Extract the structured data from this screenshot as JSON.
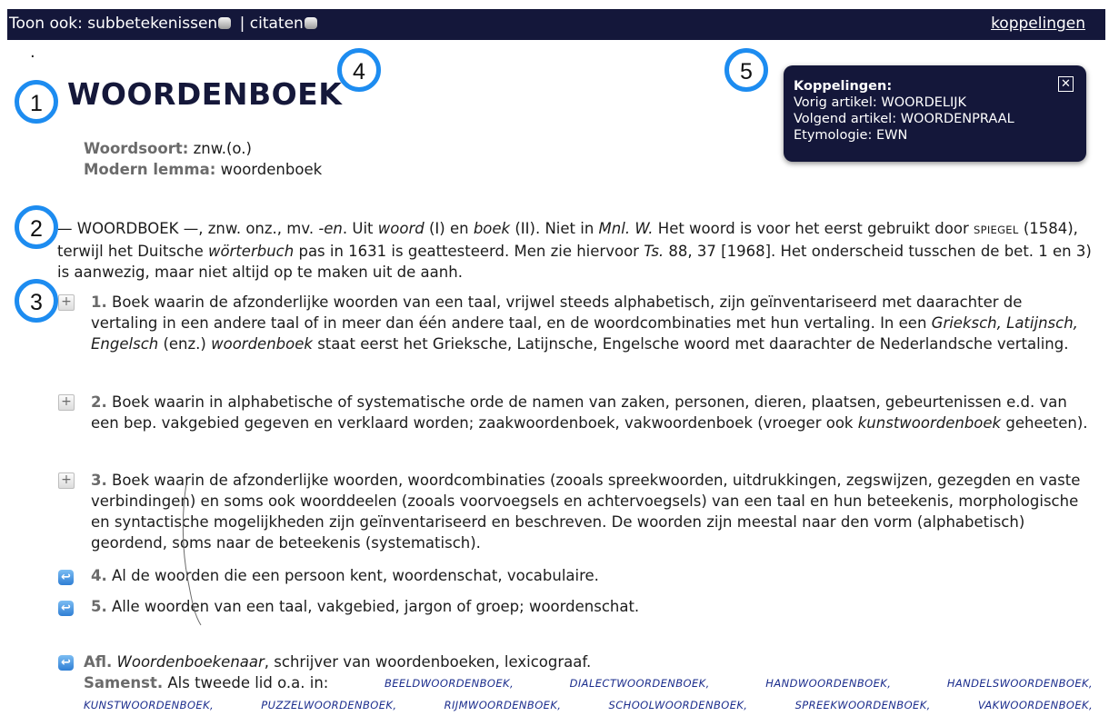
{
  "topbar": {
    "show_also": "Toon ook:",
    "subsenses": "subbetekenissen",
    "separator": "|",
    "quotes": "citaten",
    "links": "koppelingen"
  },
  "headword": "WOORDENBOEK",
  "meta": {
    "pos_label": "Woordsoort:",
    "pos_value": "znw.(o.)",
    "lemma_label": "Modern lemma:",
    "lemma_value": "woordenboek"
  },
  "popup": {
    "title": "Koppelingen:",
    "prev": "Vorig artikel: WOORDELIJK",
    "next": "Volgend artikel: WOORDENPRAAL",
    "etym": "Etymologie: EWN",
    "close": "✕"
  },
  "intro": {
    "dash1": "—",
    "word": "WOORDBOEK",
    "a": "—, znw. onz., mv.",
    "plural": "-en",
    "b": ". Uit",
    "woord": "woord",
    "c": "(I) en",
    "boek": "boek",
    "d": "(II). Niet in",
    "mnl": "Mnl. W.",
    "e": "Het woord is voor het eerst gebruikt door",
    "spiegel": "spiegel",
    "f": "(1584), terwijl het Duitsche",
    "worterbuch": "wörterbuch",
    "g": "pas in 1631 is geattesteerd. Men zie hiervoor",
    "ts": "Ts.",
    "h": "88, 37 [1968]. Het onderscheid tusschen de bet. 1 en 3) is aanwezig, maar niet altijd op te maken uit de aanh."
  },
  "senses": [
    {
      "num": "1.",
      "a": "Boek waarin de afzonderlijke woorden van een taal, vrijwel steeds alphabetisch, zijn geïnventariseerd met daarachter de vertaling in een andere taal of in meer dan één andere taal, en de woordcombinaties met hun vertaling. In een",
      "i1": "Grieksch, Latijnsch, Engelsch",
      "b": "(enz.)",
      "i2": "woordenboek",
      "c": "staat eerst het Grieksche, Latijnsche, Engelsche woord met daarachter de Nederlandsche vertaling."
    },
    {
      "num": "2.",
      "a": "Boek waarin in alphabetische of systematische orde de namen van zaken, personen, dieren, plaatsen, gebeurtenissen e.d. van een bep. vakgebied gegeven en verklaard worden; zaakwoordenboek, vakwoordenboek (vroeger ook",
      "i1": "kunstwoordenboek",
      "b": "geheeten)."
    },
    {
      "num": "3.",
      "a": "Boek waarin de afzonderlijke woorden, woordcombinaties (zooals spreekwoorden, uitdrukkingen, zegswijzen, gezegden en vaste verbindingen) en soms ook woorddeelen (zooals voorvoegsels en achtervoegsels) van een taal en hun beteekenis, morphologische en syntactische mogelijkheden zijn geïnventariseerd en beschreven. De woorden zijn meestal naar den vorm (alphabetisch) geordend, soms naar de beteekenis (systematisch)."
    },
    {
      "num": "4.",
      "a": "Al de woorden die een persoon kent, woordenschat, vocabulaire."
    },
    {
      "num": "5.",
      "a": "Alle woorden van een taal, vakgebied, jargon of groep; woordenschat."
    }
  ],
  "afl": {
    "label": "Afl.",
    "word": "Woordenboekenaar",
    "rest": ", schrijver van woordenboeken, lexicograaf."
  },
  "samenst": {
    "label": "Samenst.",
    "intro": "Als tweede lid o.a. in:",
    "row1": [
      "BEELDWOORDENBOEK,",
      "DIALECTWOORDENBOEK,",
      "HANDWOORDENBOEK,",
      "HANDELSWOORDENBOEK,"
    ],
    "row2": [
      "KUNSTWOORDENBOEK,",
      "PUZZELWOORDENBOEK,",
      "RIJMWOORDENBOEK,",
      "SCHOOLWOORDENBOEK,",
      "SPREEKWOORDENBOEK,",
      "VAKWOORDENBOEK,"
    ]
  },
  "annotations": [
    "1",
    "2",
    "3",
    "4",
    "5"
  ],
  "colors": {
    "navy": "#14173a",
    "annotation_blue": "#1d8cf0",
    "label_gray": "#6b6b6b",
    "link_blue": "#1a2c8c"
  }
}
